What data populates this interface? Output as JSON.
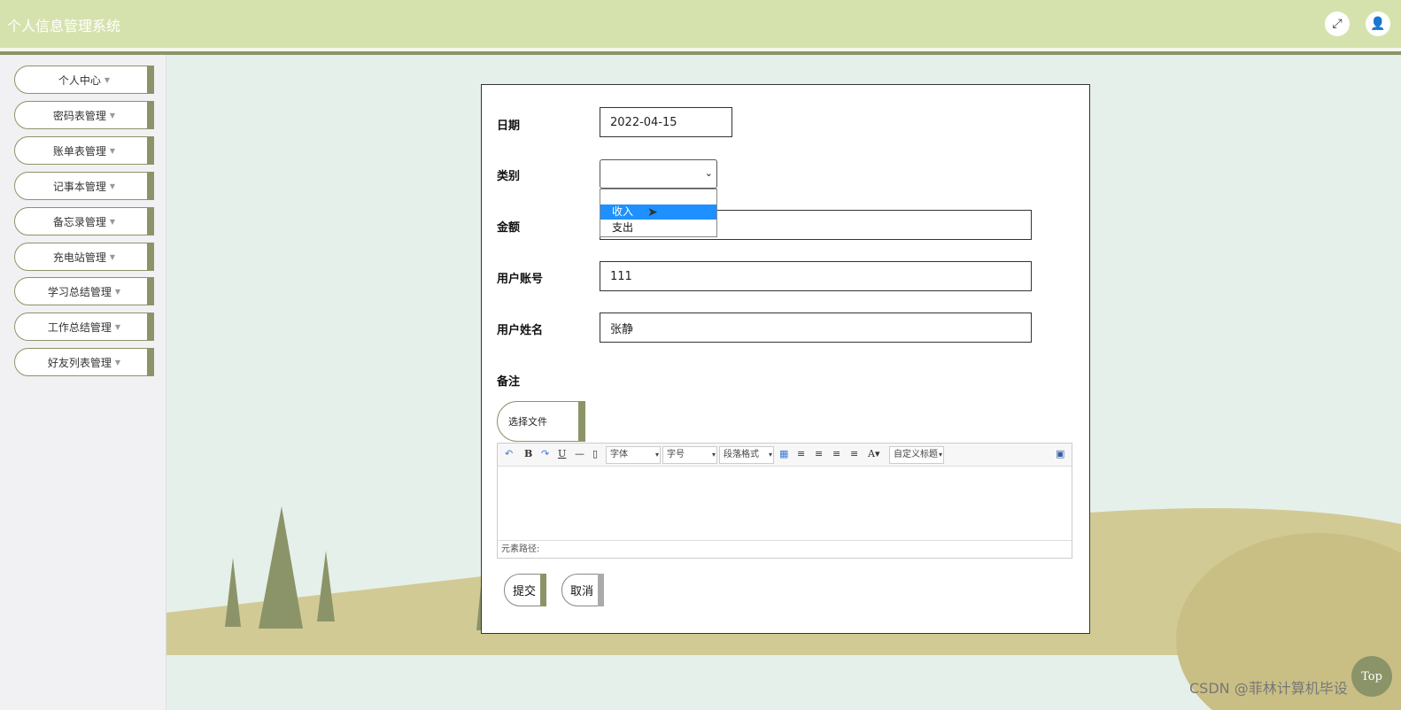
{
  "app": {
    "title": "个人信息管理系统"
  },
  "header": {
    "fullscreen_icon": "expand-icon",
    "user_icon": "user-icon"
  },
  "sidebar": {
    "items": [
      {
        "label": "个人中心"
      },
      {
        "label": "密码表管理"
      },
      {
        "label": "账单表管理"
      },
      {
        "label": "记事本管理"
      },
      {
        "label": "备忘录管理"
      },
      {
        "label": "充电站管理"
      },
      {
        "label": "学习总结管理"
      },
      {
        "label": "工作总结管理"
      },
      {
        "label": "好友列表管理"
      }
    ]
  },
  "form": {
    "date": {
      "label": "日期",
      "value": "2022-04-15"
    },
    "category": {
      "label": "类别",
      "value": "",
      "options": [
        "",
        "收入",
        "支出"
      ],
      "highlighted": "收入"
    },
    "amount": {
      "label": "金额",
      "value": ""
    },
    "account": {
      "label": "用户账号",
      "value": "111"
    },
    "username": {
      "label": "用户姓名",
      "value": "张静"
    },
    "remark": {
      "label": "备注",
      "choose_file": "选择文件"
    },
    "editor": {
      "font_family": "字体",
      "font_size": "字号",
      "paragraph": "段落格式",
      "custom_title": "自定义标题",
      "path_label": "元素路径:"
    },
    "submit": "提交",
    "cancel": "取消"
  },
  "back_to_top": "Top",
  "watermark": "CSDN @菲林计算机毕设",
  "colors": {
    "header": "#d6e2ae",
    "accent": "#8b9468",
    "background": "#e6f0ea"
  }
}
